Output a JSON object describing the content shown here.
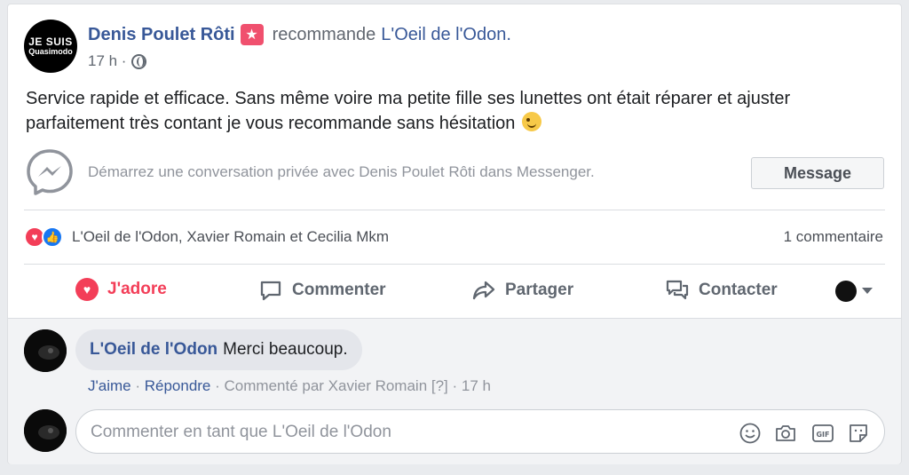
{
  "post": {
    "author": "Denis Poulet Rôti",
    "action": "recommande",
    "page": "L'Oeil de l'Odon.",
    "time": "17 h ·",
    "avatar_line1": "JE SUIS",
    "avatar_line2": "Quasimodo",
    "text": "Service rapide et efficace. Sans même voire ma petite fille ses lunettes ont était réparer et ajuster parfaitement très contant je vous recommande sans hésitation"
  },
  "messenger": {
    "prompt": "Démarrez une conversation privée avec Denis Poulet Rôti dans Messenger.",
    "button": "Message"
  },
  "reactions": {
    "names": "L'Oeil de l'Odon, Xavier Romain et Cecilia Mkm",
    "comment_count": "1 commentaire"
  },
  "actions": {
    "love": "J'adore",
    "comment": "Commenter",
    "share": "Partager",
    "contact": "Contacter"
  },
  "comment": {
    "author": "L'Oeil de l'Odon",
    "text": "Merci beaucoup.",
    "like": "J'aime",
    "reply": "Répondre",
    "meta": " · Commenté par Xavier Romain [?] · 17 h"
  },
  "composer": {
    "placeholder": "Commenter en tant que L'Oeil de l'Odon"
  },
  "colors": {
    "link": "#385898",
    "love": "#f33e58",
    "like": "#1877f2"
  }
}
